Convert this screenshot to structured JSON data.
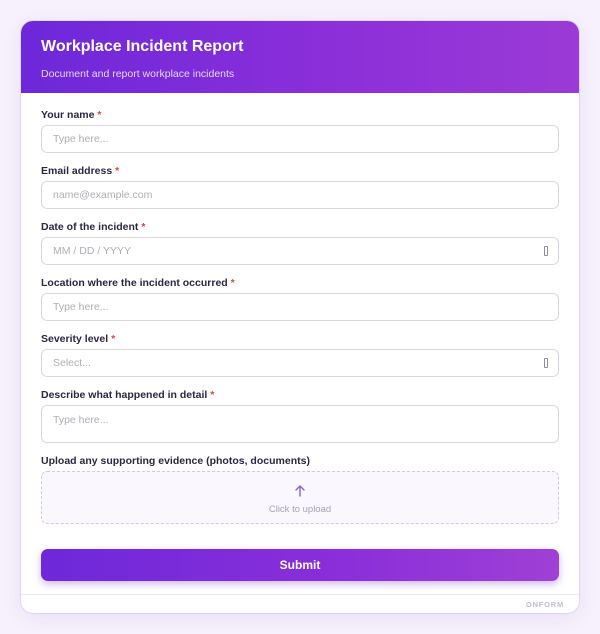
{
  "form": {
    "title": "Workplace Incident Report",
    "subtitle": "Document and report workplace incidents",
    "required_marker": "*",
    "fields": [
      {
        "label": "Your name",
        "placeholder": "Type here..."
      },
      {
        "label": "Email address",
        "placeholder": "name@example.com"
      },
      {
        "label": "Date of the incident",
        "placeholder": "MM / DD / YYYY"
      },
      {
        "label": "Location where the incident occurred",
        "placeholder": "Type here..."
      },
      {
        "label": "Severity level",
        "placeholder": "Select..."
      },
      {
        "label": "Describe what happened in detail",
        "placeholder": "Type here..."
      }
    ],
    "upload": {
      "label": "Upload any supporting evidence (photos, documents)",
      "hint": "Click to upload"
    },
    "submit_label": "Submit",
    "brand": "ONFORM"
  },
  "colors": {
    "accent": "#6d28d9",
    "accent_end": "#9b3ad6",
    "required": "#e0463e"
  }
}
